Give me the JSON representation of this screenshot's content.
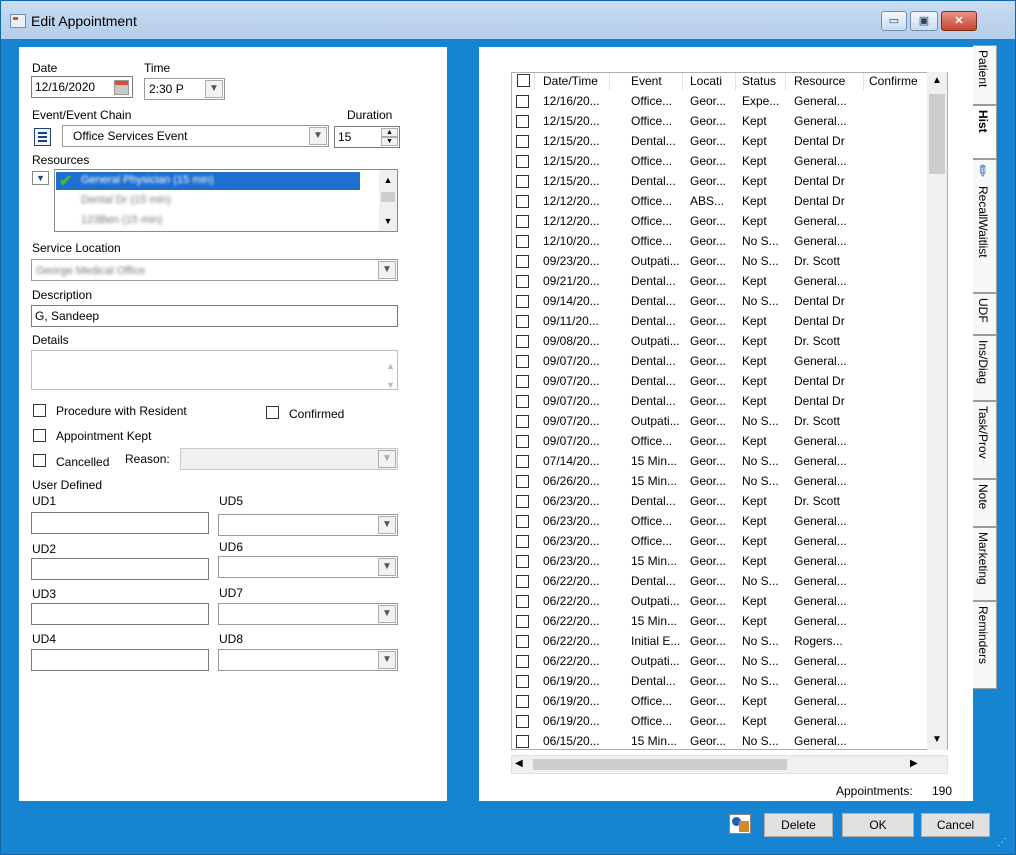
{
  "window": {
    "title": "Edit Appointment",
    "min": "▭",
    "max": "▣",
    "close": "✕"
  },
  "left": {
    "date_label": "Date",
    "date_value": "12/16/2020",
    "time_label": "Time",
    "time_value": "2:30 P",
    "event_label": "Event/Event Chain",
    "event_value": "Office Services Event",
    "duration_label": "Duration",
    "duration_value": "15",
    "resources_label": "Resources",
    "resources": [
      "General Physician (15 min)",
      "Dental Dr (15 min)",
      "123Ben (15 min)"
    ],
    "service_location_label": "Service Location",
    "service_location_value": "George Medical Office",
    "description_label": "Description",
    "description_value": "G, Sandeep",
    "details_label": "Details",
    "details_value": "",
    "procedure_label": "Procedure with Resident",
    "confirmed_label": "Confirmed",
    "kept_label": "Appointment Kept",
    "cancelled_label": "Cancelled",
    "reason_label": "Reason:",
    "user_defined_label": "User Defined",
    "ud": [
      {
        "label": "UD1",
        "value": ""
      },
      {
        "label": "UD2",
        "value": ""
      },
      {
        "label": "UD3",
        "value": ""
      },
      {
        "label": "UD4",
        "value": ""
      },
      {
        "label": "UD5",
        "value": ""
      },
      {
        "label": "UD6",
        "value": ""
      },
      {
        "label": "UD7",
        "value": ""
      },
      {
        "label": "UD8",
        "value": ""
      }
    ]
  },
  "grid": {
    "columns": [
      "Date/Time",
      "Event",
      "Locati",
      "Status",
      "Resource",
      "Confirme"
    ],
    "rows": [
      [
        "12/16/20...",
        "Office...",
        "Geor...",
        "Expe...",
        "General..."
      ],
      [
        "12/15/20...",
        "Office...",
        "Geor...",
        "Kept",
        "General..."
      ],
      [
        "12/15/20...",
        "Dental...",
        "Geor...",
        "Kept",
        "Dental Dr"
      ],
      [
        "12/15/20...",
        "Office...",
        "Geor...",
        "Kept",
        "General..."
      ],
      [
        "12/15/20...",
        "Dental...",
        "Geor...",
        "Kept",
        "Dental Dr"
      ],
      [
        "12/12/20...",
        "Office...",
        "ABS...",
        "Kept",
        "Dental Dr"
      ],
      [
        "12/12/20...",
        "Office...",
        "Geor...",
        "Kept",
        "General..."
      ],
      [
        "12/10/20...",
        "Office...",
        "Geor...",
        "No S...",
        "General..."
      ],
      [
        "09/23/20...",
        "Outpati...",
        "Geor...",
        "No S...",
        "Dr. Scott"
      ],
      [
        "09/21/20...",
        "Dental...",
        "Geor...",
        "Kept",
        "General..."
      ],
      [
        "09/14/20...",
        "Dental...",
        "Geor...",
        "No S...",
        "Dental Dr"
      ],
      [
        "09/11/20...",
        "Dental...",
        "Geor...",
        "Kept",
        "Dental Dr"
      ],
      [
        "09/08/20...",
        "Outpati...",
        "Geor...",
        "Kept",
        "Dr. Scott"
      ],
      [
        "09/07/20...",
        "Dental...",
        "Geor...",
        "Kept",
        "General..."
      ],
      [
        "09/07/20...",
        "Dental...",
        "Geor...",
        "Kept",
        "Dental Dr"
      ],
      [
        "09/07/20...",
        "Dental...",
        "Geor...",
        "Kept",
        "Dental Dr"
      ],
      [
        "09/07/20...",
        "Outpati...",
        "Geor...",
        "No S...",
        "Dr. Scott"
      ],
      [
        "09/07/20...",
        "Office...",
        "Geor...",
        "Kept",
        "General..."
      ],
      [
        "07/14/20...",
        "15 Min...",
        "Geor...",
        "No S...",
        "General..."
      ],
      [
        "06/26/20...",
        "15 Min...",
        "Geor...",
        "No S...",
        "General..."
      ],
      [
        "06/23/20...",
        "Dental...",
        "Geor...",
        "Kept",
        "Dr. Scott"
      ],
      [
        "06/23/20...",
        "Office...",
        "Geor...",
        "Kept",
        "General..."
      ],
      [
        "06/23/20...",
        "Office...",
        "Geor...",
        "Kept",
        "General..."
      ],
      [
        "06/23/20...",
        "15 Min...",
        "Geor...",
        "Kept",
        "General..."
      ],
      [
        "06/22/20...",
        "Dental...",
        "Geor...",
        "No S...",
        "General..."
      ],
      [
        "06/22/20...",
        "Outpati...",
        "Geor...",
        "Kept",
        "General..."
      ],
      [
        "06/22/20...",
        "15 Min...",
        "Geor...",
        "Kept",
        "General..."
      ],
      [
        "06/22/20...",
        "Initial E...",
        "Geor...",
        "No S...",
        "Rogers..."
      ],
      [
        "06/22/20...",
        "Outpati...",
        "Geor...",
        "No S...",
        "General..."
      ],
      [
        "06/19/20...",
        "Dental...",
        "Geor...",
        "No S...",
        "General..."
      ],
      [
        "06/19/20...",
        "Office...",
        "Geor...",
        "Kept",
        "General..."
      ],
      [
        "06/19/20...",
        "Office...",
        "Geor...",
        "Kept",
        "General..."
      ],
      [
        "06/15/20...",
        "15 Min...",
        "Geor...",
        "No S...",
        "General..."
      ]
    ],
    "appointments_label": "Appointments:",
    "appointments_count": "190"
  },
  "tabs": [
    "Patient",
    "Hist",
    "RecallWaitlist",
    "UDF",
    "Ins/Diag",
    "Task/Prov",
    "Note",
    "Marketing",
    "Reminders"
  ],
  "buttons": {
    "delete": "Delete",
    "ok": "OK",
    "cancel": "Cancel"
  }
}
